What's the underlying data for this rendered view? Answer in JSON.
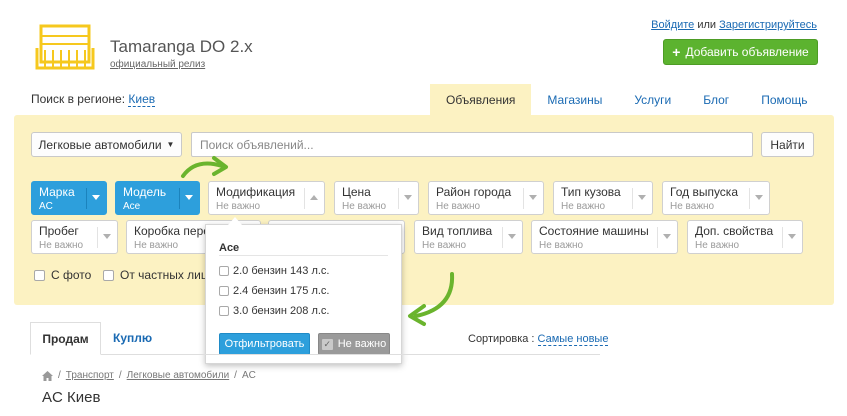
{
  "header": {
    "site_title": "Tamaranga DO 2.x",
    "site_subtitle": "официальный релиз",
    "login": "Войдите",
    "or": " или ",
    "register": "Зарегистрируйтесь",
    "add_button": "Добавить объявление"
  },
  "region": {
    "label": "Поиск в регионе: ",
    "value": "Киев"
  },
  "nav": {
    "items": [
      "Объявления",
      "Магазины",
      "Услуги",
      "Блог",
      "Помощь"
    ],
    "active_index": 0
  },
  "search": {
    "category": "Легковые автомобили",
    "placeholder": "Поиск объявлений...",
    "find_button": "Найти"
  },
  "filters": [
    {
      "title": "Марка",
      "sub": "AC",
      "state": "selected"
    },
    {
      "title": "Модель",
      "sub": "Ace",
      "state": "selected"
    },
    {
      "title": "Модификация",
      "sub": "Не важно",
      "state": "open"
    },
    {
      "title": "Цена",
      "sub": "Не важно"
    },
    {
      "title": "Район города",
      "sub": "Не важно"
    },
    {
      "title": "Тип кузова",
      "sub": "Не важно"
    },
    {
      "title": "Год выпуска",
      "sub": "Не важно"
    },
    {
      "title": "Пробег",
      "sub": "Не важно"
    },
    {
      "title": "Коробка пере",
      "sub": "Не важно"
    },
    {
      "title": "Вид топлива",
      "sub": "Не важно"
    },
    {
      "title": "Состояние машины",
      "sub": "Не важно"
    },
    {
      "title": "Доп. свойства",
      "sub": "Не важно"
    }
  ],
  "checkboxes": {
    "with_photo": "С фото",
    "private": "От частных лиц"
  },
  "popup": {
    "title": "Ace",
    "options": [
      "2.0 бензин 143 л.с.",
      "2.4 бензин 175 л.с.",
      "3.0 бензин 208 л.с."
    ],
    "filter_button": "Отфильтровать",
    "not_important_button": "Не важно"
  },
  "tabs": {
    "sell": "Продам",
    "buy": "Куплю",
    "sort_label": "Сортировка : ",
    "sort_value": "Самые новые"
  },
  "breadcrumbs": [
    "Транспорт",
    "Легковые автомобили",
    "AC"
  ],
  "page_heading": "AC Киев",
  "colors": {
    "accent_blue": "#2d9fdc",
    "link_blue": "#1a6ab3",
    "green": "#5cb32f",
    "panel_yellow": "#fcf2c2",
    "logo_yellow": "#f6c81e",
    "arrow_green": "#6ab42d"
  }
}
